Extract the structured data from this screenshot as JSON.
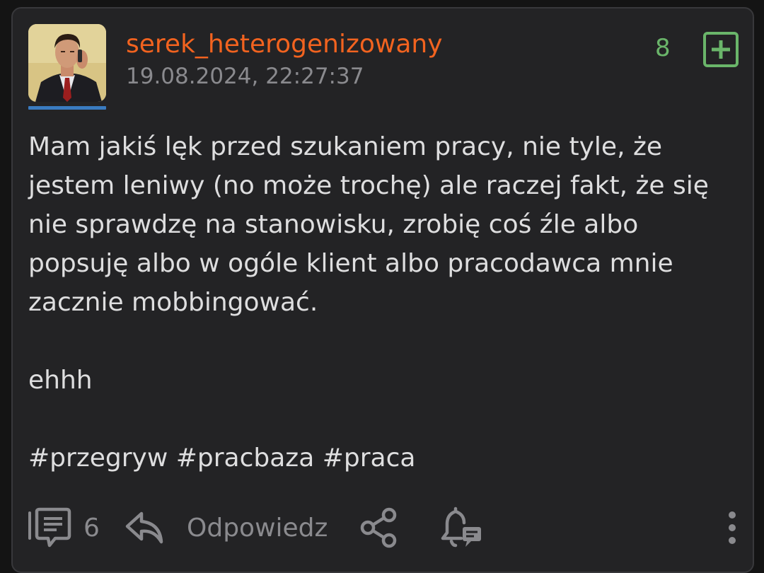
{
  "post": {
    "username": "serek_heterogenizowany",
    "datetime": "19.08.2024, 22:27:37",
    "score": "8",
    "body": {
      "line1": "Mam jakiś lęk przed szukaniem pracy, nie tyle, że",
      "line2": "jestem leniwy (no może trochę) ale raczej fakt, że się",
      "line3": "nie sprawdzę na stanowisku, zrobię coś źle albo",
      "line4": "popsuję albo w ogóle klient albo pracodawca mnie",
      "line5": "zacznie mobbingować.",
      "line6": "ehhh"
    },
    "tags": [
      "#przegryw",
      "#pracbaza",
      "#praca"
    ]
  },
  "actions": {
    "comments_count": "6",
    "reply_label": "Odpowiedz"
  },
  "icons": {
    "avatar": "avatar-photo",
    "upvote": "plus-square-icon",
    "comments": "comments-icon",
    "reply": "reply-arrow-icon",
    "share": "share-icon",
    "notify": "bell-comment-icon",
    "more": "more-vertical-icon"
  },
  "colors": {
    "username": "#f2631f",
    "score": "#6ab56a",
    "avatar_bar": "#3a7bc0",
    "background": "#232325"
  }
}
